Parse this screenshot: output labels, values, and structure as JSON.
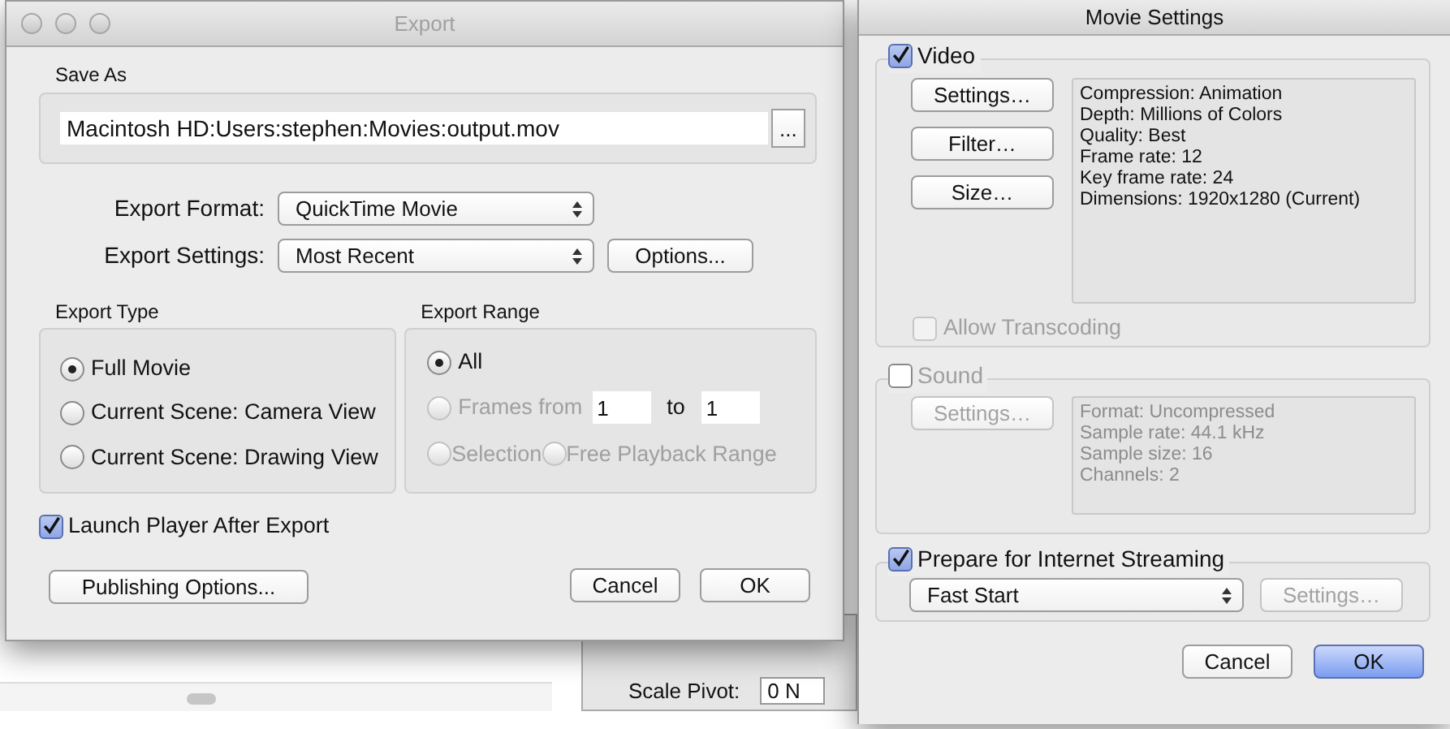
{
  "background_app": {
    "fields": [
      {
        "label": "Scale Pivot:",
        "value": "0 N"
      }
    ]
  },
  "export_window": {
    "title": "Export",
    "save_as": {
      "label": "Save As",
      "path": "Macintosh HD:Users:stephen:Movies:output.mov",
      "browse_button": "..."
    },
    "format": {
      "label": "Export Format:",
      "value": "QuickTime Movie"
    },
    "settings": {
      "label": "Export Settings:",
      "value": "Most Recent",
      "button": "Options..."
    },
    "export_type": {
      "title": "Export Type",
      "options": [
        {
          "label": "Full Movie",
          "selected": true
        },
        {
          "label": "Current Scene: Camera View",
          "selected": false
        },
        {
          "label": "Current Scene: Drawing View",
          "selected": false
        }
      ]
    },
    "export_range": {
      "title": "Export Range",
      "options": [
        {
          "kind": "all",
          "label": "All",
          "selected": true,
          "disabled": false
        },
        {
          "kind": "frames",
          "label": "Frames from",
          "from": "1",
          "to_label": "to",
          "to": "1",
          "selected": false,
          "disabled": true
        },
        {
          "kind": "selection",
          "label": "Selection",
          "selected": false,
          "disabled": true
        },
        {
          "kind": "free",
          "label": "Free Playback Range",
          "selected": false,
          "disabled": true
        }
      ]
    },
    "launch_player": {
      "label": "Launch Player After Export",
      "checked": true
    },
    "buttons": [
      {
        "kind": "publishing",
        "label": "Publishing Options..."
      },
      {
        "kind": "cancel",
        "label": "Cancel"
      },
      {
        "kind": "ok",
        "label": "OK"
      }
    ]
  },
  "movie_settings": {
    "title": "Movie Settings",
    "video": {
      "label": "Video",
      "checked": true,
      "buttons": [
        "Settings…",
        "Filter…",
        "Size…"
      ],
      "info": [
        "Compression: Animation",
        "Depth: Millions of Colors",
        "Quality: Best",
        "Frame rate: 12",
        "Key frame rate: 24",
        "Dimensions: 1920x1280 (Current)"
      ],
      "allow_transcoding": {
        "label": "Allow Transcoding",
        "checked": false,
        "disabled": true
      }
    },
    "sound": {
      "label": "Sound",
      "checked": false,
      "settings_button": {
        "label": "Settings…",
        "disabled": true
      },
      "info": [
        "Format: Uncompressed",
        "Sample rate: 44.1 kHz",
        "Sample size: 16",
        "Channels: 2"
      ]
    },
    "streaming": {
      "label": "Prepare for Internet Streaming",
      "checked": true,
      "select": "Fast Start",
      "settings_button": {
        "label": "Settings…",
        "disabled": true
      }
    },
    "buttons": [
      {
        "label": "Cancel",
        "default": false
      },
      {
        "label": "OK",
        "default": true
      }
    ]
  }
}
